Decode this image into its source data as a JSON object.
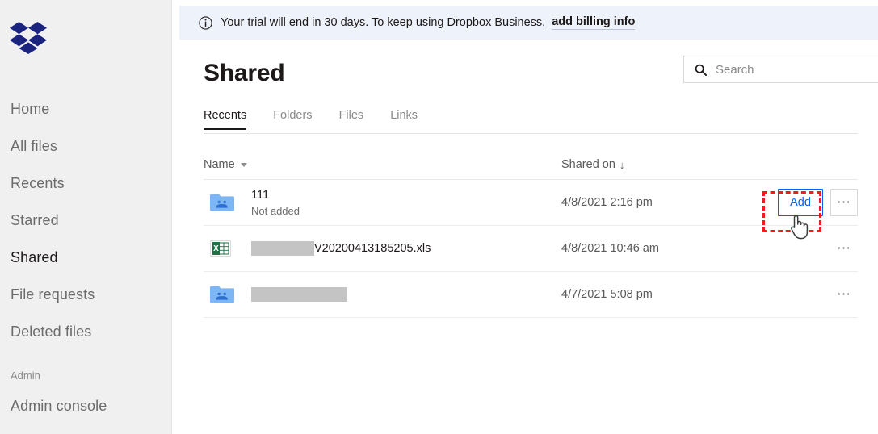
{
  "brand": {
    "logo_name": "dropbox-logo",
    "logo_color": "#1a237e",
    "accent_color": "#0061fe",
    "annotation_color": "#f31b1b"
  },
  "sidebar": {
    "items": [
      {
        "label": "Home",
        "name": "sidebar-item-home",
        "active": false
      },
      {
        "label": "All files",
        "name": "sidebar-item-all-files",
        "active": false
      },
      {
        "label": "Recents",
        "name": "sidebar-item-recents",
        "active": false
      },
      {
        "label": "Starred",
        "name": "sidebar-item-starred",
        "active": false
      },
      {
        "label": "Shared",
        "name": "sidebar-item-shared",
        "active": true
      },
      {
        "label": "File requests",
        "name": "sidebar-item-file-requests",
        "active": false
      },
      {
        "label": "Deleted files",
        "name": "sidebar-item-deleted-files",
        "active": false
      }
    ],
    "section_label": "Admin",
    "admin_items": [
      {
        "label": "Admin console",
        "name": "sidebar-item-admin-console"
      }
    ]
  },
  "banner": {
    "icon": "info-circle-icon",
    "text": "Your trial will end in 30 days. To keep using Dropbox Business,",
    "link_label": "add billing info"
  },
  "header": {
    "title": "Shared"
  },
  "search": {
    "icon": "search-icon",
    "placeholder": "Search",
    "value": ""
  },
  "tabs": [
    {
      "label": "Recents",
      "name": "tab-recents",
      "active": true
    },
    {
      "label": "Folders",
      "name": "tab-folders",
      "active": false
    },
    {
      "label": "Files",
      "name": "tab-files",
      "active": false
    },
    {
      "label": "Links",
      "name": "tab-links",
      "active": false
    }
  ],
  "table": {
    "columns": {
      "name": "Name",
      "name_sort_icon": "caret-down-icon",
      "shared_on": "Shared on",
      "shared_on_sort_icon": "arrow-down-icon"
    },
    "rows": [
      {
        "icon": "shared-folder-icon",
        "title": "111",
        "title_redacted": false,
        "subtitle": "Not added",
        "shared_on": "4/8/2021 2:16 pm",
        "action_label": "Add",
        "has_add_button": true,
        "overflow_icon": "ellipsis-icon",
        "overflow_bordered": true
      },
      {
        "icon": "excel-file-icon",
        "title": "V20200413185205.xls",
        "title_redacted": true,
        "redact_width": 78,
        "subtitle": "",
        "shared_on": "4/8/2021 10:46 am",
        "action_label": "",
        "has_add_button": false,
        "overflow_icon": "ellipsis-icon",
        "overflow_bordered": false
      },
      {
        "icon": "shared-folder-icon",
        "title": "",
        "title_redacted": true,
        "redact_width": 119,
        "subtitle": "",
        "shared_on": "4/7/2021 5:08 pm",
        "action_label": "",
        "has_add_button": false,
        "overflow_icon": "ellipsis-icon",
        "overflow_bordered": false
      }
    ]
  },
  "annotation": {
    "target": "add-button",
    "cursor_icon": "hand-pointer-cursor"
  }
}
